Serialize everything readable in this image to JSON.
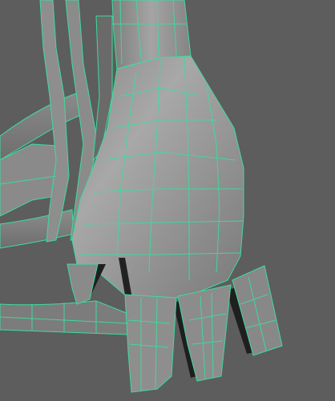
{
  "viewport": {
    "background": "#5d5d5d",
    "wireframe_color": "#3ddc9e",
    "surface_light": "#9a9a9a",
    "surface_mid": "#868686",
    "surface_dark": "#6f6f6f",
    "shadow": "#1f1f1f"
  }
}
